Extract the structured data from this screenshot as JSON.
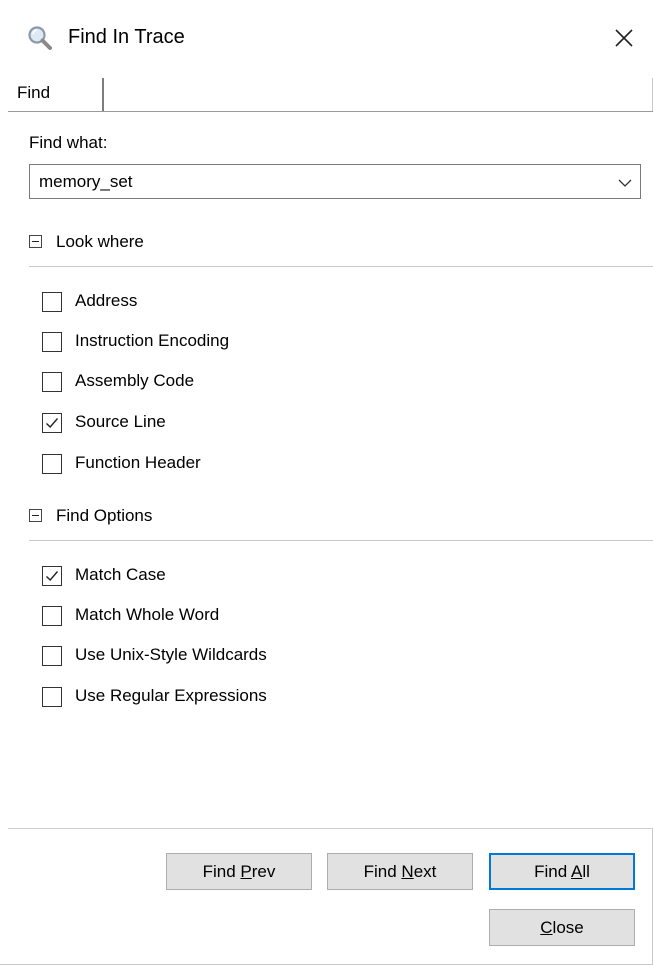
{
  "window": {
    "title": "Find In Trace"
  },
  "tabs": [
    {
      "label": "Find"
    }
  ],
  "find_what": {
    "label": "Find what:",
    "value": "memory_set"
  },
  "look_where": {
    "title": "Look where",
    "options": [
      {
        "label": "Address",
        "checked": false
      },
      {
        "label": "Instruction Encoding",
        "checked": false
      },
      {
        "label": "Assembly Code",
        "checked": false
      },
      {
        "label": "Source Line",
        "checked": true
      },
      {
        "label": "Function Header",
        "checked": false
      }
    ]
  },
  "find_options": {
    "title": "Find Options",
    "options": [
      {
        "label": "Match Case",
        "checked": true
      },
      {
        "label": "Match Whole Word",
        "checked": false
      },
      {
        "label": "Use Unix-Style Wildcards",
        "checked": false
      },
      {
        "label": "Use Regular Expressions",
        "checked": false
      }
    ]
  },
  "buttons": {
    "find_prev": {
      "pre": "Find ",
      "accel": "P",
      "post": "rev"
    },
    "find_next": {
      "pre": "Find ",
      "accel": "N",
      "post": "ext"
    },
    "find_all": {
      "pre": "Find ",
      "accel": "A",
      "post": "ll"
    },
    "close": {
      "pre": "",
      "accel": "C",
      "post": "lose"
    }
  },
  "colors": {
    "focus_border": "#0078d7",
    "button_face": "#e1e1e1"
  },
  "icons": {
    "title": "search-magnifier-icon",
    "close": "close-icon",
    "dropdown": "chevron-down-icon"
  }
}
